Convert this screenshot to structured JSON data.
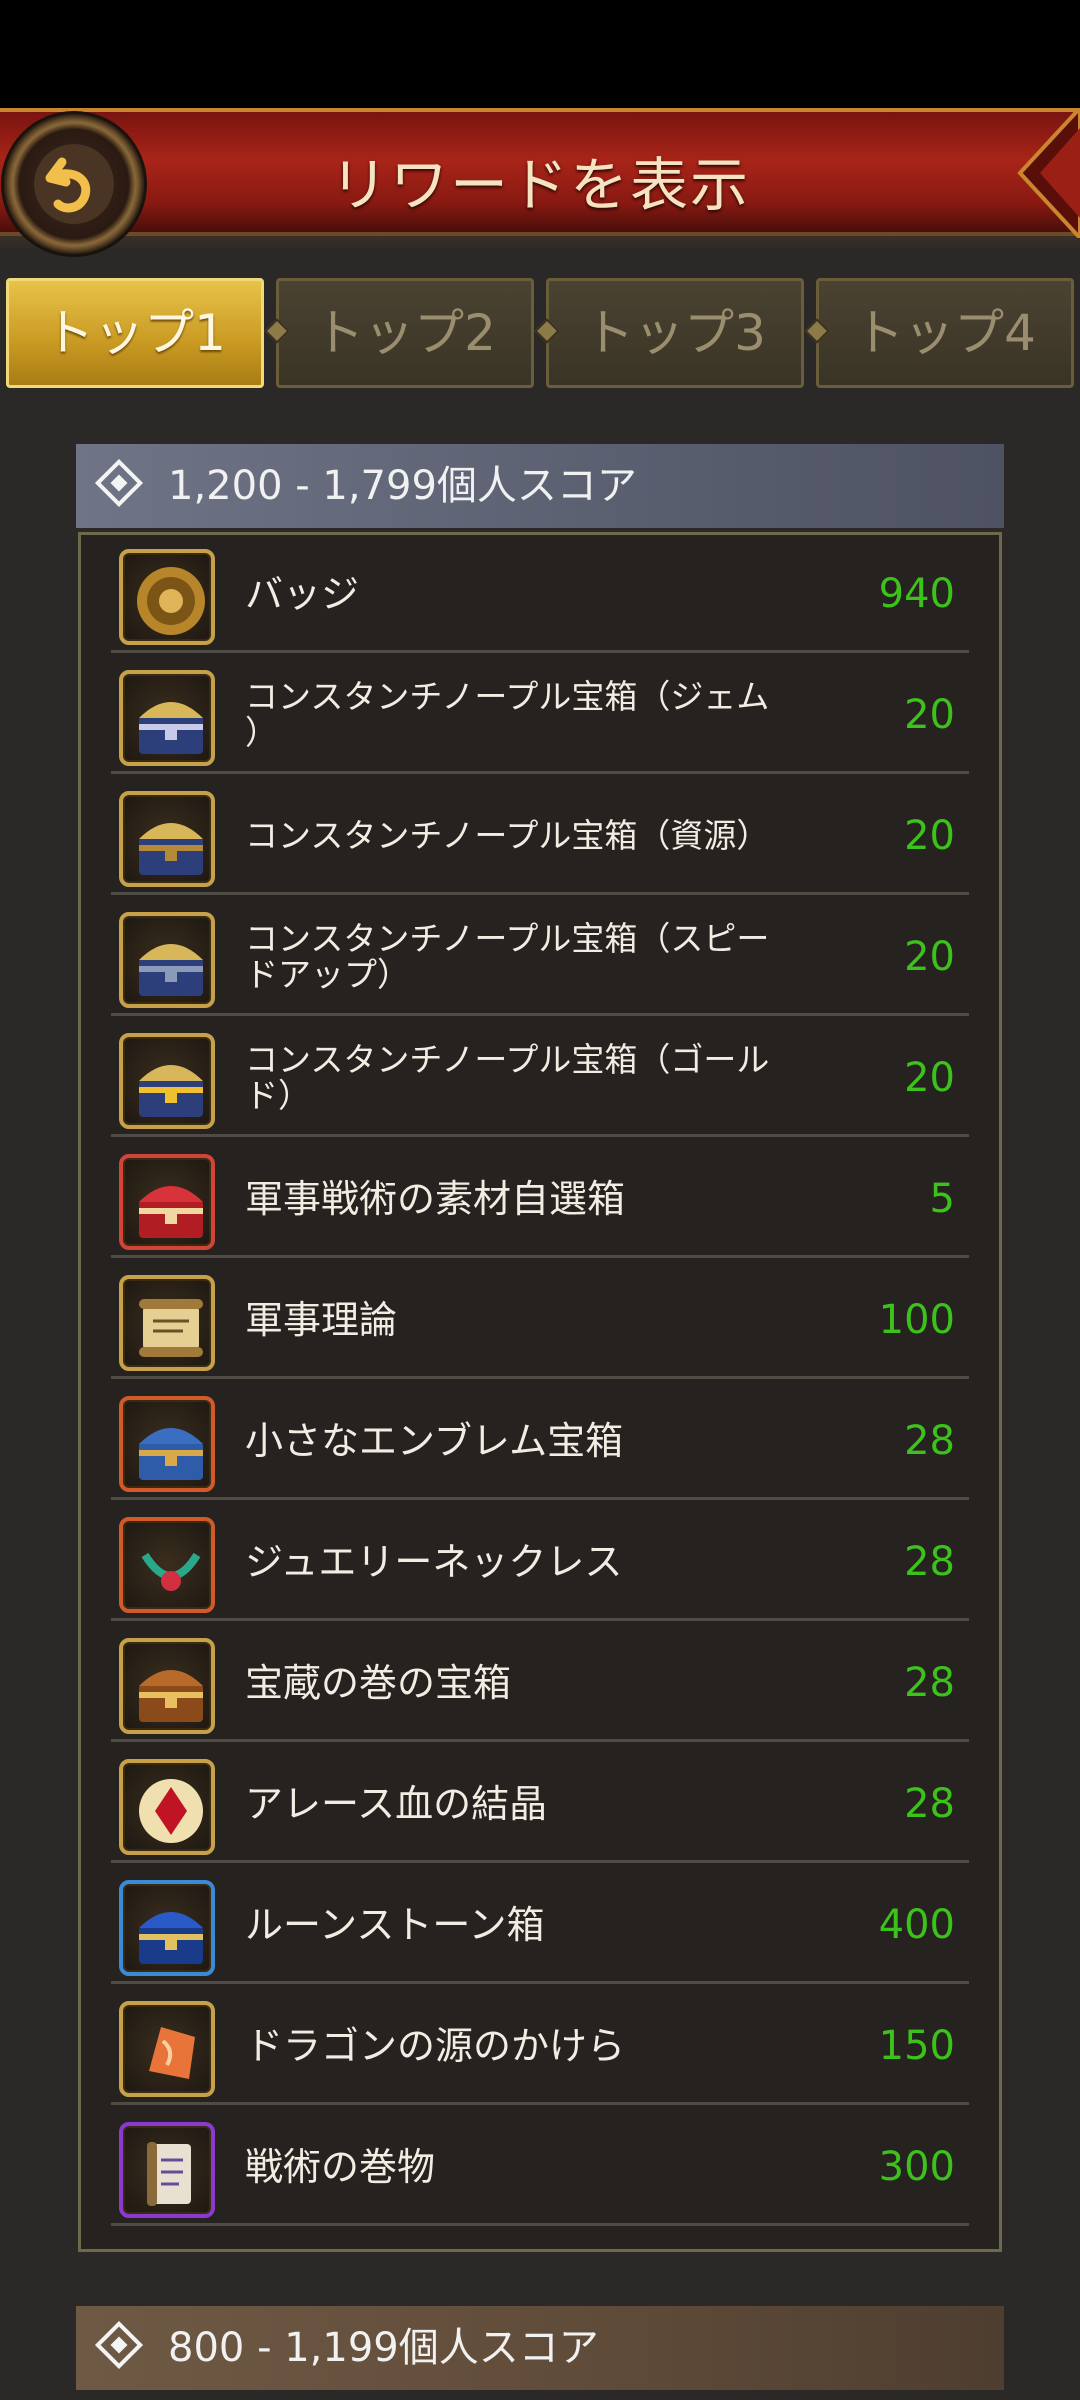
{
  "header": {
    "title": "リワードを表示"
  },
  "tabs": [
    {
      "label": "トップ1",
      "active": true
    },
    {
      "label": "トップ2",
      "active": false
    },
    {
      "label": "トップ3",
      "active": false
    },
    {
      "label": "トップ4",
      "active": false
    }
  ],
  "sections": [
    {
      "label": "1,200 - 1,799個人スコア"
    },
    {
      "label": "800 - 1,199個人スコア"
    }
  ],
  "rewards": [
    {
      "name": "バッジ",
      "qty": "940",
      "icon": "badge-icon",
      "frame": "#c6a14a"
    },
    {
      "name": "コンスタンチノープル宝箱（ジェム\n）",
      "qty": "20",
      "icon": "gem-chest-icon",
      "frame": "#c6a14a"
    },
    {
      "name": "コンスタンチノープル宝箱（資源）",
      "qty": "20",
      "icon": "resource-chest-icon",
      "frame": "#c6a14a"
    },
    {
      "name": "コンスタンチノープル宝箱（スピー\nドアップ）",
      "qty": "20",
      "icon": "speedup-chest-icon",
      "frame": "#c6a14a"
    },
    {
      "name": "コンスタンチノープル宝箱（ゴール\nド）",
      "qty": "20",
      "icon": "gold-chest-icon",
      "frame": "#c6a14a"
    },
    {
      "name": "軍事戦術の素材自選箱",
      "qty": "5",
      "icon": "red-chest-icon",
      "frame": "#d0443a"
    },
    {
      "name": "軍事理論",
      "qty": "100",
      "icon": "scroll-icon",
      "frame": "#c6a14a"
    },
    {
      "name": "小さなエンブレム宝箱",
      "qty": "28",
      "icon": "emblem-chest-icon",
      "frame": "#d05a2a"
    },
    {
      "name": "ジュエリーネックレス",
      "qty": "28",
      "icon": "necklace-icon",
      "frame": "#d05a2a"
    },
    {
      "name": "宝蔵の巻の宝箱",
      "qty": "28",
      "icon": "treasure-chest-icon",
      "frame": "#c6a14a"
    },
    {
      "name": "アレース血の結晶",
      "qty": "28",
      "icon": "blood-crystal-icon",
      "frame": "#c6a14a"
    },
    {
      "name": "ルーンストーン箱",
      "qty": "400",
      "icon": "runestone-box-icon",
      "frame": "#3a8ad8"
    },
    {
      "name": "ドラゴンの源のかけら",
      "qty": "150",
      "icon": "dragon-shard-icon",
      "frame": "#c6a14a"
    },
    {
      "name": "戦術の巻物",
      "qty": "300",
      "icon": "tactics-scroll-icon",
      "frame": "#8a3ad0"
    }
  ]
}
